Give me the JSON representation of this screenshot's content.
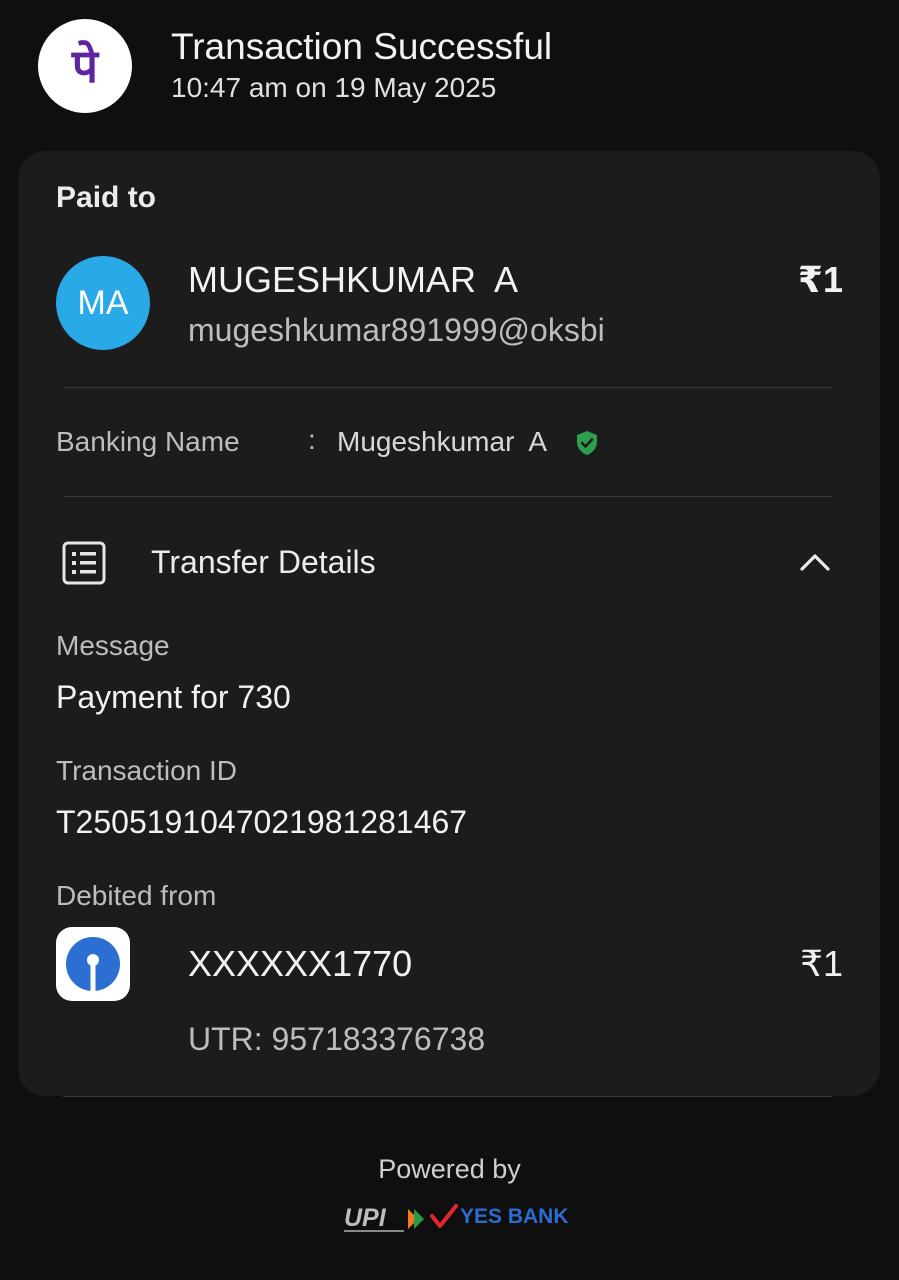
{
  "header": {
    "app_logo_glyph": "पे",
    "title": "Transaction Successful",
    "subtitle": "10:47 am on 19 May 2025"
  },
  "paid_to": {
    "label": "Paid to",
    "avatar_initials": "MA",
    "avatar_color": "#2aa9e9",
    "name": "MUGESHKUMAR  A",
    "vpa": "mugeshkumar891999@oksbi",
    "amount": "₹1"
  },
  "banking": {
    "label": "Banking Name",
    "separator": ":",
    "value": "Mugeshkumar  A",
    "verified_icon": "verified-shield-icon"
  },
  "transfer_details": {
    "title": "Transfer Details",
    "icon": "receipt-list-icon",
    "toggle_icon": "chevron-up-icon",
    "message_label": "Message",
    "message_value": "Payment for 730",
    "txn_label": "Transaction ID",
    "txn_value": "T2505191047021981281467",
    "debited_label": "Debited from",
    "account": "XXXXXX1770",
    "account_amount": "₹1",
    "utr": "UTR: 957183376738"
  },
  "footer": {
    "powered_by": "Powered by",
    "upi_logo_text": "UPI",
    "bank_text": "YES BANK"
  },
  "colors": {
    "background": "#0f0f0f",
    "card": "#1c1c1c",
    "brand_purple": "#5f259f",
    "verified_green": "#2e9e4f",
    "yes_bank_blue": "#2d6ccf"
  }
}
